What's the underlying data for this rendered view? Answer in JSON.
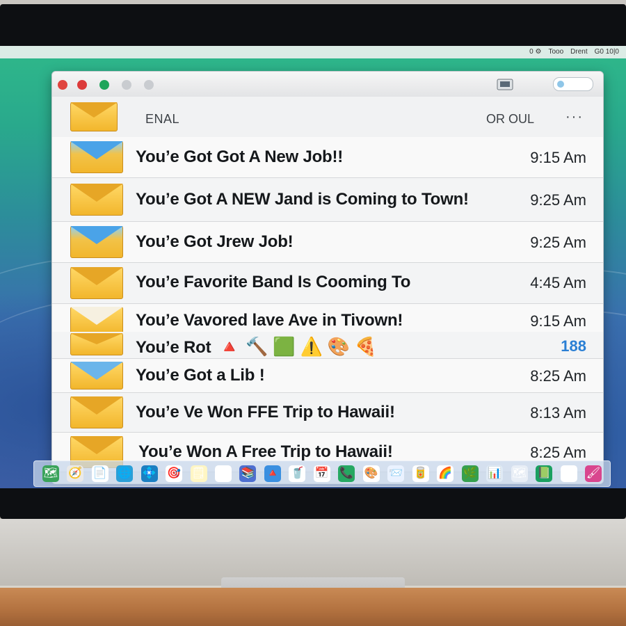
{
  "menubar": {
    "status_items": [
      "0 ⚙",
      "Tooo",
      "Drent",
      "G0 10|0"
    ]
  },
  "window": {
    "header_title": "ENAL",
    "header_right": "OR OUL",
    "header_more": "···"
  },
  "emails": [
    {
      "subject": "You’e Got Got  A  New Job!!",
      "time": "9:15 Am",
      "icon": "envelope-blue-icon"
    },
    {
      "subject": "You’e Got A NEW Jand is Coming to Town!",
      "time": "9:25 Am",
      "icon": "envelope-icon"
    },
    {
      "subject": "You’e Got Jrew Job!",
      "time": "9:25 Am",
      "icon": "envelope-blue-icon"
    },
    {
      "subject": "You’e Favorite Band Is Cooming To",
      "time": "4:45 Am",
      "icon": "envelope-icon"
    },
    {
      "subject": "You’e Vavored lave Ave in Tivown!",
      "time": "9:15 Am",
      "icon": "envelope-open-icon"
    },
    {
      "subject": "You’e Rot",
      "emoji": "🔺 🔨 🟩 ⚠️ 🎨 🍕",
      "time": "188",
      "icon": "envelope-icon"
    },
    {
      "subject": "You’e Got a Lib !",
      "time": "8:25 Am",
      "icon": "envelope-open-icon"
    },
    {
      "subject": "You’e Ve Won FFE Trip to Hawaii!",
      "time": "8:13 Am",
      "icon": "envelope-icon"
    },
    {
      "subject": "You’e Won A Free Trip to Hawaii!",
      "time": "8:25 Am",
      "icon": "envelope-icon"
    }
  ],
  "dock": {
    "icons": [
      "🗺",
      "🧭",
      "📄",
      "🌐",
      "💠",
      "🎯",
      "🗒",
      "🖼",
      "📚",
      "🔺",
      "🥤",
      "📅",
      "📞",
      "🎨",
      "📨",
      "🥫",
      "🌈",
      "🌿",
      "📊",
      "🗺",
      "📗",
      "⏺",
      "🖌"
    ]
  },
  "colors": {
    "wallpaper_top": "#2fb88a",
    "wallpaper_bottom": "#4160a8",
    "close": "#e0443e",
    "minimize": "#dc3b3b",
    "zoom": "#1fa55a"
  }
}
